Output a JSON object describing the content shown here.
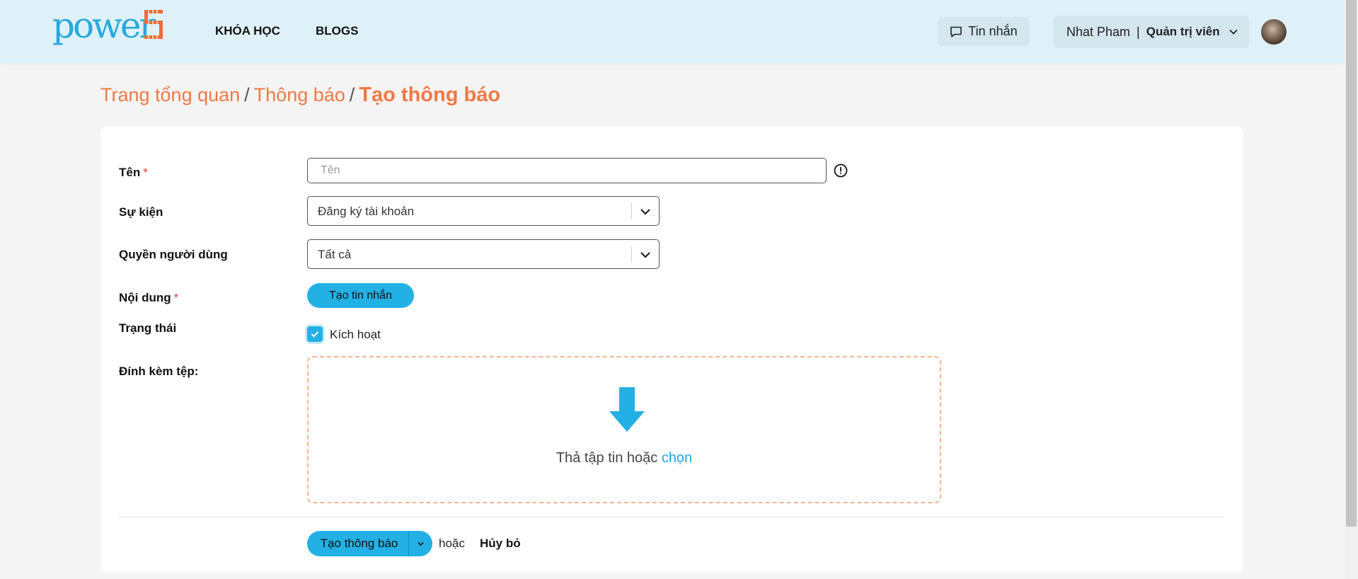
{
  "header": {
    "logo_text": "power",
    "nav": [
      "KHÓA HỌC",
      "BLOGS"
    ],
    "messages_label": "Tin nhắn",
    "user_name": "Nhat Pham",
    "user_separator": "|",
    "user_role": "Quản trị viên"
  },
  "breadcrumb": {
    "items": [
      "Trang tổng quan",
      "Thông báo"
    ],
    "separator": "/",
    "current": "Tạo thông báo"
  },
  "form": {
    "name_label": "Tên",
    "name_placeholder": "Tên",
    "name_value": "",
    "required_mark": "*",
    "event_label": "Sự kiện",
    "event_value": "Đăng ký tài khoản",
    "permission_label": "Quyền người dùng",
    "permission_value": "Tất cả",
    "content_label": "Nội dung",
    "create_message_button": "Tạo tin nhắn",
    "status_label": "Trạng thái",
    "active_label": "Kích hoạt",
    "active_checked": true,
    "attachment_label": "Đính kèm tệp:",
    "drop_text": "Thả tập tin hoặc",
    "drop_link": "chọn"
  },
  "actions": {
    "submit_label": "Tạo thông báo",
    "or_text": "hoặc",
    "cancel_label": "Hủy bỏ"
  },
  "colors": {
    "accent_blue": "#23b0e4",
    "breadcrumb_orange": "#ee7a45",
    "header_bg": "#def1f9",
    "required_red": "#e53935",
    "dropzone_border": "#f6b48d"
  }
}
